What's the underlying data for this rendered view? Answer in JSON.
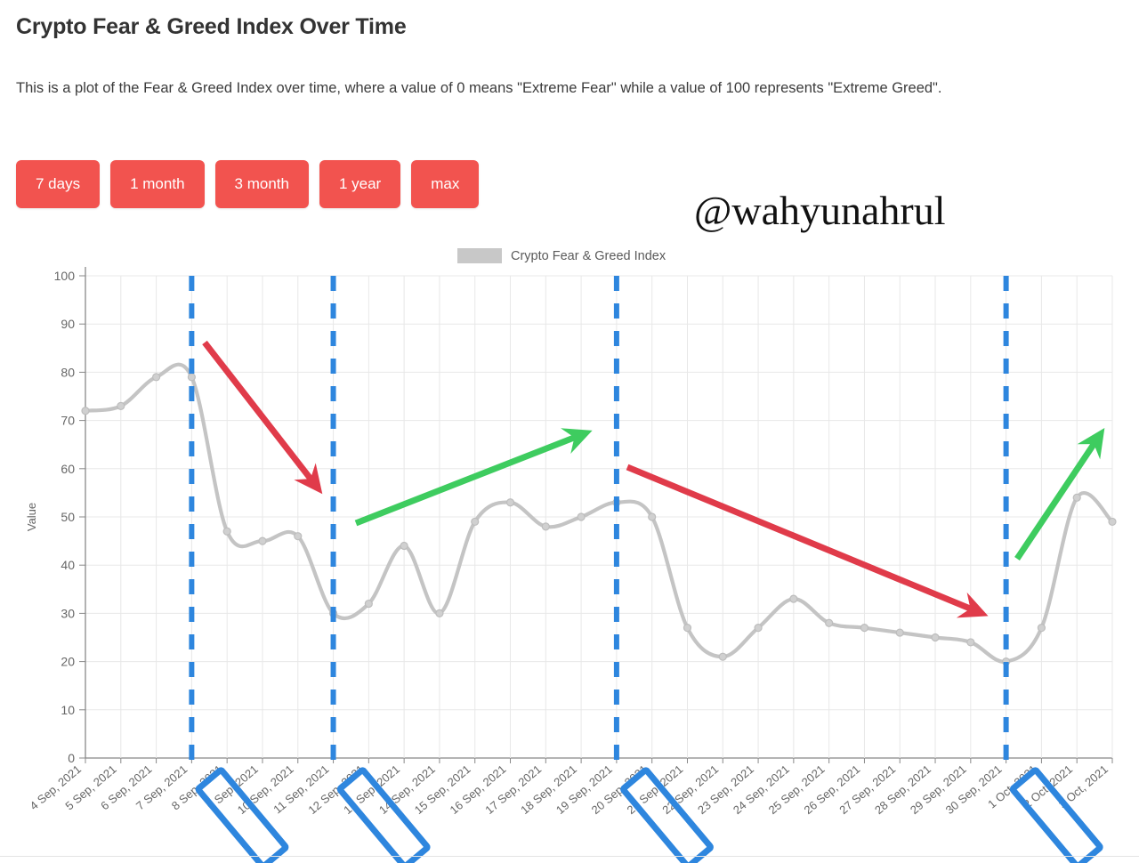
{
  "header": {
    "title": "Crypto Fear & Greed Index Over Time",
    "description": "This is a plot of the Fear & Greed Index over time, where a value of 0 means \"Extreme Fear\" while a value of 100 represents \"Extreme Greed\"."
  },
  "range_buttons": [
    {
      "label": "7 days"
    },
    {
      "label": "1 month"
    },
    {
      "label": "3 month"
    },
    {
      "label": "1 year"
    },
    {
      "label": "max"
    }
  ],
  "watermark": {
    "text": "@wahyunahrul"
  },
  "legend": {
    "label": "Crypto Fear & Greed Index",
    "color": "#c8c8c8"
  },
  "colors": {
    "button_red": "#f2534f",
    "line_gray": "#c4c4c4",
    "marker_gray": "#bdbdbd",
    "grid": "#e8e8e8",
    "axis": "#888888",
    "annotation_blue": "#2e86de",
    "annotation_red": "#e03b4a",
    "annotation_green": "#3ecc5f",
    "text": "#666666"
  },
  "annotations": {
    "highlighted_dates": [
      "7 Sep, 2021",
      "11 Sep, 2021",
      "19 Sep, 2021",
      "30 Sep, 2021"
    ],
    "trend_arrows": [
      {
        "direction": "down",
        "color": "#e03b4a"
      },
      {
        "direction": "up",
        "color": "#3ecc5f"
      },
      {
        "direction": "down",
        "color": "#e03b4a"
      },
      {
        "direction": "up",
        "color": "#3ecc5f"
      }
    ]
  },
  "chart_data": {
    "type": "line",
    "title": "Crypto Fear & Greed Index Over Time",
    "xlabel": "",
    "ylabel": "Value",
    "ylim": [
      0,
      100
    ],
    "yticks": [
      0,
      10,
      20,
      30,
      40,
      50,
      60,
      70,
      80,
      90,
      100
    ],
    "grid": true,
    "legend_position": "top",
    "series_name": "Crypto Fear & Greed Index",
    "categories": [
      "4 Sep, 2021",
      "5 Sep, 2021",
      "6 Sep, 2021",
      "7 Sep, 2021",
      "8 Sep, 2021",
      "9 Sep, 2021",
      "10 Sep, 2021",
      "11 Sep, 2021",
      "12 Sep, 2021",
      "13 Sep, 2021",
      "14 Sep, 2021",
      "15 Sep, 2021",
      "16 Sep, 2021",
      "17 Sep, 2021",
      "18 Sep, 2021",
      "19 Sep, 2021",
      "20 Sep, 2021",
      "21 Sep, 2021",
      "22 Sep, 2021",
      "23 Sep, 2021",
      "24 Sep, 2021",
      "25 Sep, 2021",
      "26 Sep, 2021",
      "27 Sep, 2021",
      "28 Sep, 2021",
      "29 Sep, 2021",
      "30 Sep, 2021",
      "1 Oct, 2021",
      "2 Oct, 2021",
      "3 Oct, 2021"
    ],
    "values": [
      72,
      73,
      79,
      79,
      47,
      45,
      46,
      30,
      32,
      44,
      30,
      49,
      53,
      48,
      50,
      53,
      50,
      27,
      21,
      27,
      33,
      28,
      27,
      26,
      25,
      24,
      20,
      27,
      54,
      49
    ]
  }
}
